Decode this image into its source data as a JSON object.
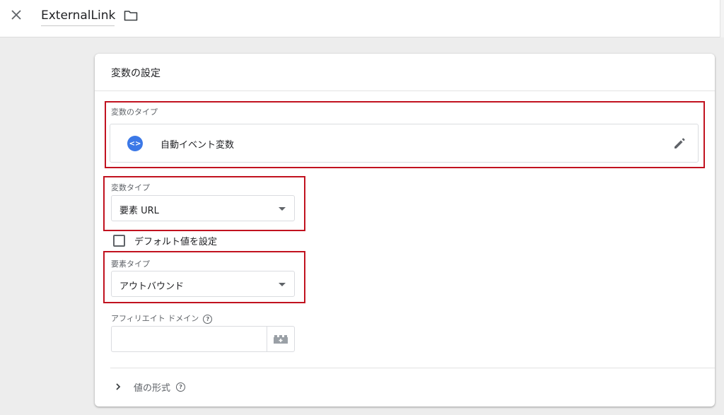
{
  "header": {
    "title": "ExternalLink"
  },
  "card": {
    "title": "変数の設定",
    "variable_type_section": {
      "label": "変数のタイプ",
      "selected_name": "自動イベント変数",
      "icon_glyph": "<>"
    },
    "variable_kind": {
      "label": "変数タイプ",
      "value": "要素 URL"
    },
    "default_value": {
      "label": "デフォルト値を設定",
      "checked": false
    },
    "element_type": {
      "label": "要素タイプ",
      "value": "アウトバウンド"
    },
    "affiliate_domain": {
      "label": "アフィリエイト ドメイン",
      "help_glyph": "?",
      "value": ""
    },
    "value_format": {
      "label": "値の形式",
      "help_glyph": "?"
    }
  },
  "colors": {
    "accent_blue": "#3b78e7",
    "highlight_red": "#c1121f",
    "background": "#ededed"
  },
  "icons": [
    "close-icon",
    "folder-icon",
    "code-icon",
    "pencil-icon",
    "caret-down-icon",
    "help-icon",
    "lego-brick-icon",
    "chevron-right-icon"
  ]
}
